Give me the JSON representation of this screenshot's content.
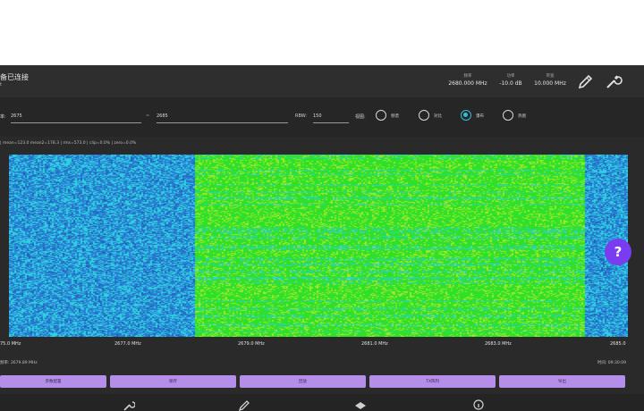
{
  "header": {
    "connection_status": "备已连接",
    "connection_sub": "t",
    "stats": [
      {
        "label": "频率",
        "value": "2680.000 MHz"
      },
      {
        "label": "功率",
        "value": "-10.0 dB"
      },
      {
        "label": "带宽",
        "value": "10.000 MHz"
      }
    ],
    "icons": [
      "edit-icon",
      "wrench-icon"
    ]
  },
  "controls": {
    "freq_label": "率:",
    "freq_start": "2675",
    "freq_sep": "~",
    "freq_end": "2685",
    "rbw_label": "RBW:",
    "rbw_value": "150",
    "mode_label": "视图:",
    "modes": [
      {
        "label": "频谱",
        "selected": false
      },
      {
        "label": "对比",
        "selected": false
      },
      {
        "label": "瀑布",
        "selected": true
      },
      {
        "label": "热图",
        "selected": false
      }
    ]
  },
  "stats_line": "| mean=123.0 mean2=178.3 | rms=573.0 | clip=0.0% | zero=0.0%",
  "spectrogram": {
    "freq_ticks": [
      "75.0 MHz",
      "2677.0 MHz",
      "2679.0 MHz",
      "2681.0 MHz",
      "2683.0 MHz",
      "2685.0"
    ],
    "x_range_mhz": [
      2675,
      2685
    ],
    "signal_band_mhz": [
      2678.0,
      2684.3
    ],
    "colors": {
      "noise_low": "#2a7fd6",
      "noise_high": "#2fd0e0",
      "signal": "#2ee02a",
      "signal_hi": "#a0e82a"
    }
  },
  "info": {
    "left": "频率: 2679.89 MHz",
    "right": "时间: 09:30:09"
  },
  "buttons": [
    "参数配置",
    "保存",
    "回放",
    "TX阵列",
    "导出"
  ],
  "nav_icons": [
    "wrench-nav-icon",
    "pen-nav-icon",
    "layers-nav-icon",
    "info-nav-icon"
  ],
  "help_label": "?"
}
